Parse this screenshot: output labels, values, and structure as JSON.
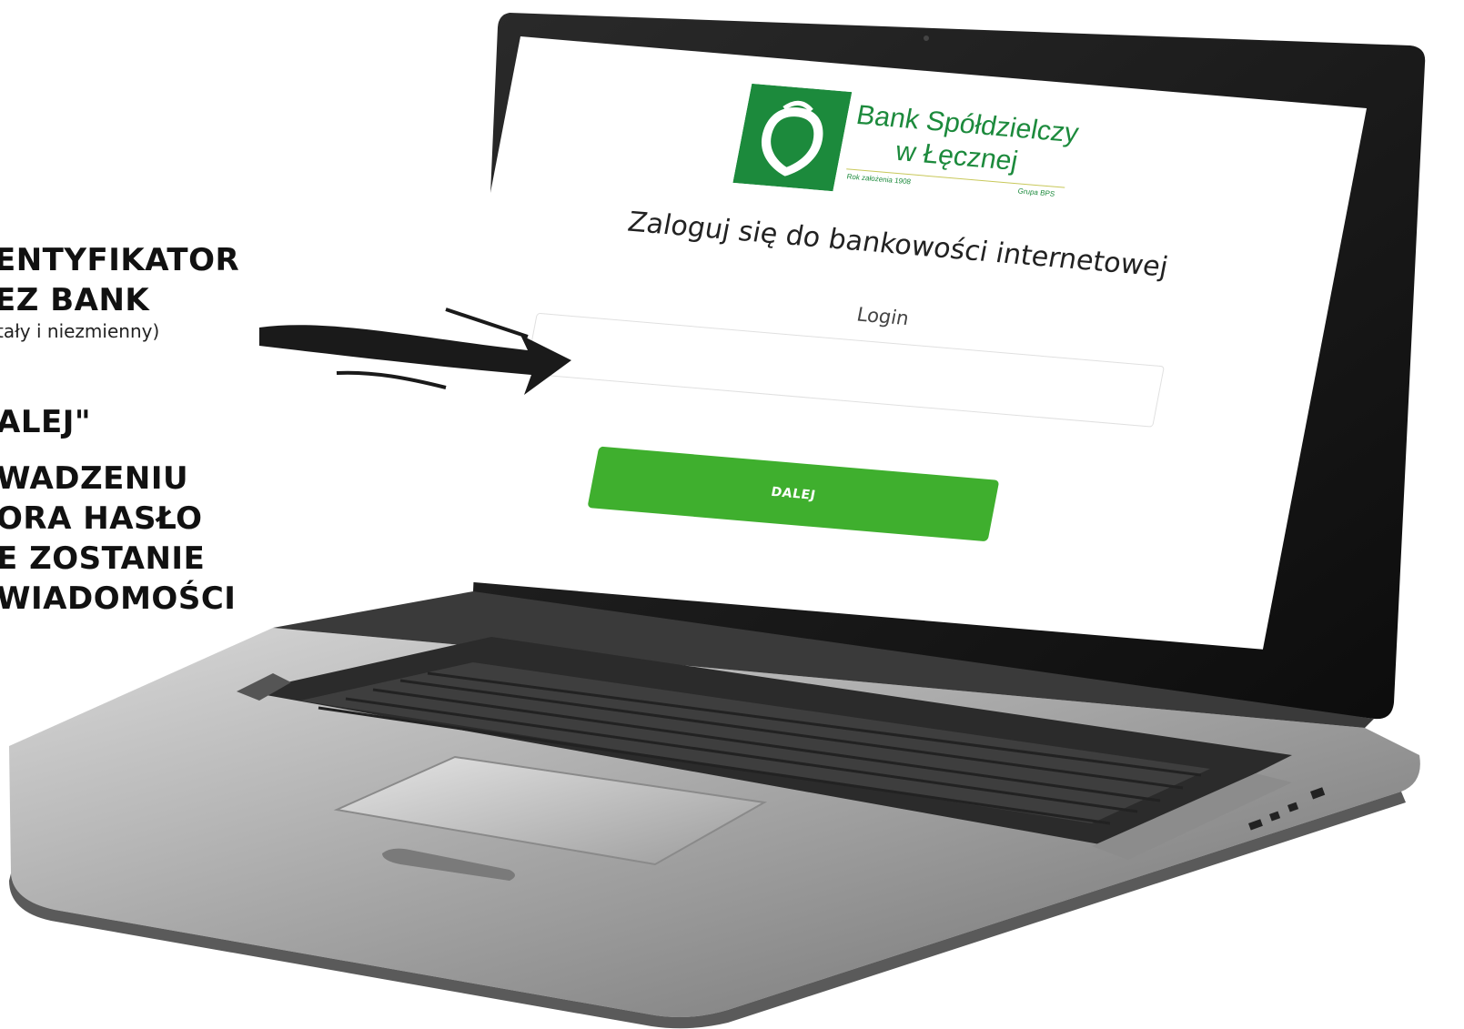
{
  "annotation": {
    "line1": "ENTYFIKATOR",
    "line2": "EZ BANK",
    "line3": "tały i niezmienny)",
    "line4": "ALEJ\"",
    "line5": "WADZENIU",
    "line6": "ORA HASŁO",
    "line7": "E ZOSTANIE",
    "line8": "WIADOMOŚCI"
  },
  "logo": {
    "name_line1": "Bank Spółdzielczy",
    "name_line2": "w Łęcznej",
    "tagline_left": "Rok założenia 1908",
    "tagline_right": "Grupa BPS",
    "color": "#1c8a3c"
  },
  "login_form": {
    "title": "Zaloguj się do bankowości internetowej",
    "login_label": "Login",
    "login_value": "",
    "login_placeholder": "",
    "next_button": "DALEJ"
  },
  "colors": {
    "button": "#3faf2e",
    "brand_green": "#1c8a3c",
    "laptop_body": "#9a9a9a",
    "bezel": "#1a1a1a"
  }
}
